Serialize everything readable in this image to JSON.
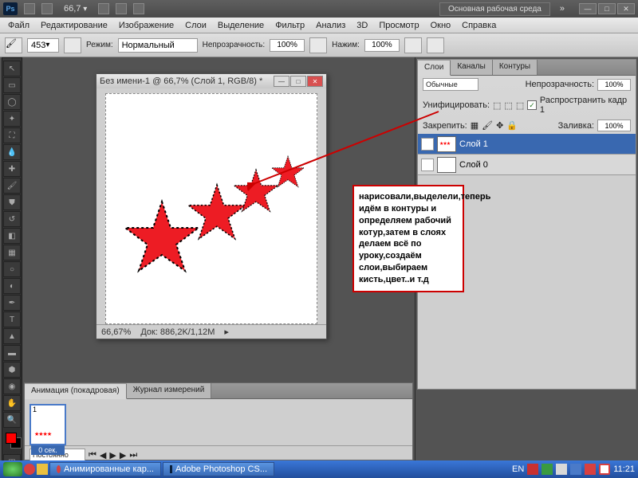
{
  "app": {
    "ps": "Ps",
    "zoom": "66,7",
    "workspace": "Основная рабочая среда"
  },
  "menu": [
    "Файл",
    "Редактирование",
    "Изображение",
    "Слои",
    "Выделение",
    "Фильтр",
    "Анализ",
    "3D",
    "Просмотр",
    "Окно",
    "Справка"
  ],
  "opt": {
    "brush_size": "453",
    "mode_lbl": "Режим:",
    "mode": "Нормальный",
    "opacity_lbl": "Непрозрачность:",
    "opacity": "100%",
    "flow_lbl": "Нажим:",
    "flow": "100%"
  },
  "doc": {
    "title": "Без имени-1 @ 66,7% (Слой 1, RGB/8) *",
    "zoom": "66,67%",
    "info": "Док: 886,2K/1,12M"
  },
  "callout": "нарисовали,выделели,теперь идём в контуры и определяем рабочий котур,затем в слоях делаем всё по уроку,создаём слои,выбираем кисть,цвет..и т.д",
  "layers_panel": {
    "tabs": [
      "Слои",
      "Каналы",
      "Контуры"
    ],
    "blend": "Обычные",
    "opacity_lbl": "Непрозрачность:",
    "opacity": "100%",
    "unify_lbl": "Унифицировать:",
    "propagate": "Распространить кадр 1",
    "lock_lbl": "Закрепить:",
    "fill_lbl": "Заливка:",
    "fill": "100%",
    "layers": [
      {
        "name": "Слой 1",
        "active": true
      },
      {
        "name": "Слой 0",
        "active": false
      }
    ]
  },
  "anim": {
    "tabs": [
      "Анимация (покадровая)",
      "Журнал измерений"
    ],
    "frame_num": "1",
    "frame_dur": "0 сек.",
    "loop": "Постоянно"
  },
  "taskbar": {
    "tasks": [
      "Анимированные кар...",
      "Adobe Photoshop CS..."
    ],
    "lang": "EN",
    "time": "11:21"
  }
}
